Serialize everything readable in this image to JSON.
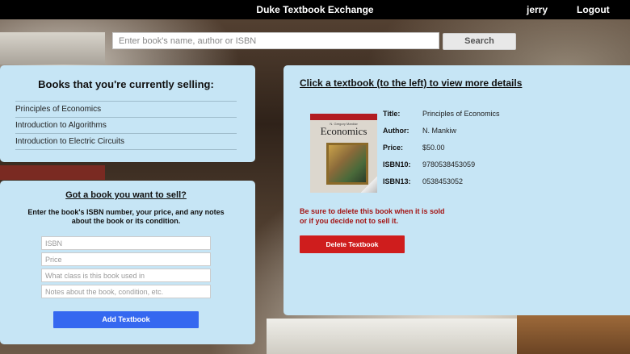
{
  "header": {
    "brand": "Duke Textbook Exchange",
    "username": "jerry",
    "logout_label": "Logout"
  },
  "search": {
    "placeholder": "Enter book's name, author or ISBN",
    "value": "",
    "button_label": "Search"
  },
  "selling": {
    "title": "Books that you're currently selling:",
    "books": [
      "Principles of Economics",
      "Introduction to Algorithms",
      "Introduction to Electric Circuits"
    ]
  },
  "sell_form": {
    "title": "Got a book you want to sell?",
    "instructions_line1": "Enter the book's ISBN number, your price, and any notes",
    "instructions_line2": "about the book or its condition.",
    "isbn_placeholder": "ISBN",
    "price_placeholder": "Price",
    "class_placeholder": "What class is this book used in",
    "notes_placeholder": "Notes about the book, condition, etc.",
    "add_button_label": "Add Textbook"
  },
  "details": {
    "heading": "Click a textbook (to the left) to view more details",
    "cover": {
      "author": "N. Gregory Mankiw",
      "title": "Economics"
    },
    "fields": [
      {
        "label": "Title:",
        "value": "Principles of Economics"
      },
      {
        "label": "Author:",
        "value": "N. Mankiw"
      },
      {
        "label": "Price:",
        "value": "$50.00"
      },
      {
        "label": "ISBN10:",
        "value": "9780538453059"
      },
      {
        "label": "ISBN13:",
        "value": "0538453052"
      }
    ],
    "warning_line1": "Be sure to delete this book when it is sold",
    "warning_line2": "or if you decide not to sell it.",
    "delete_button_label": "Delete Textbook"
  },
  "colors": {
    "topbar": "#000000",
    "panel": "#c6e5f5",
    "add_button": "#3568f0",
    "delete_button": "#cf1d1d",
    "warning_text": "#a31515"
  }
}
